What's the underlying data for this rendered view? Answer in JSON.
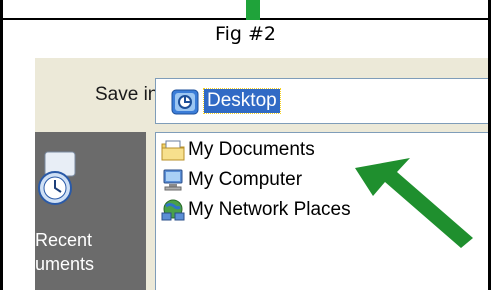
{
  "caption": "Fig #2",
  "dialog": {
    "save_in_label": "Save in:",
    "save_in_value": "Desktop",
    "places": {
      "recent_label_line1": "Recent",
      "recent_label_line2": "uments"
    },
    "items": [
      {
        "label": "My Documents",
        "icon": "folder-docs-icon"
      },
      {
        "label": "My Computer",
        "icon": "computer-icon"
      },
      {
        "label": "My Network Places",
        "icon": "network-icon"
      }
    ]
  },
  "colors": {
    "accent_arrow": "#1f8f2e",
    "selection": "#316ac5",
    "dialog_bg": "#ece9d8"
  }
}
